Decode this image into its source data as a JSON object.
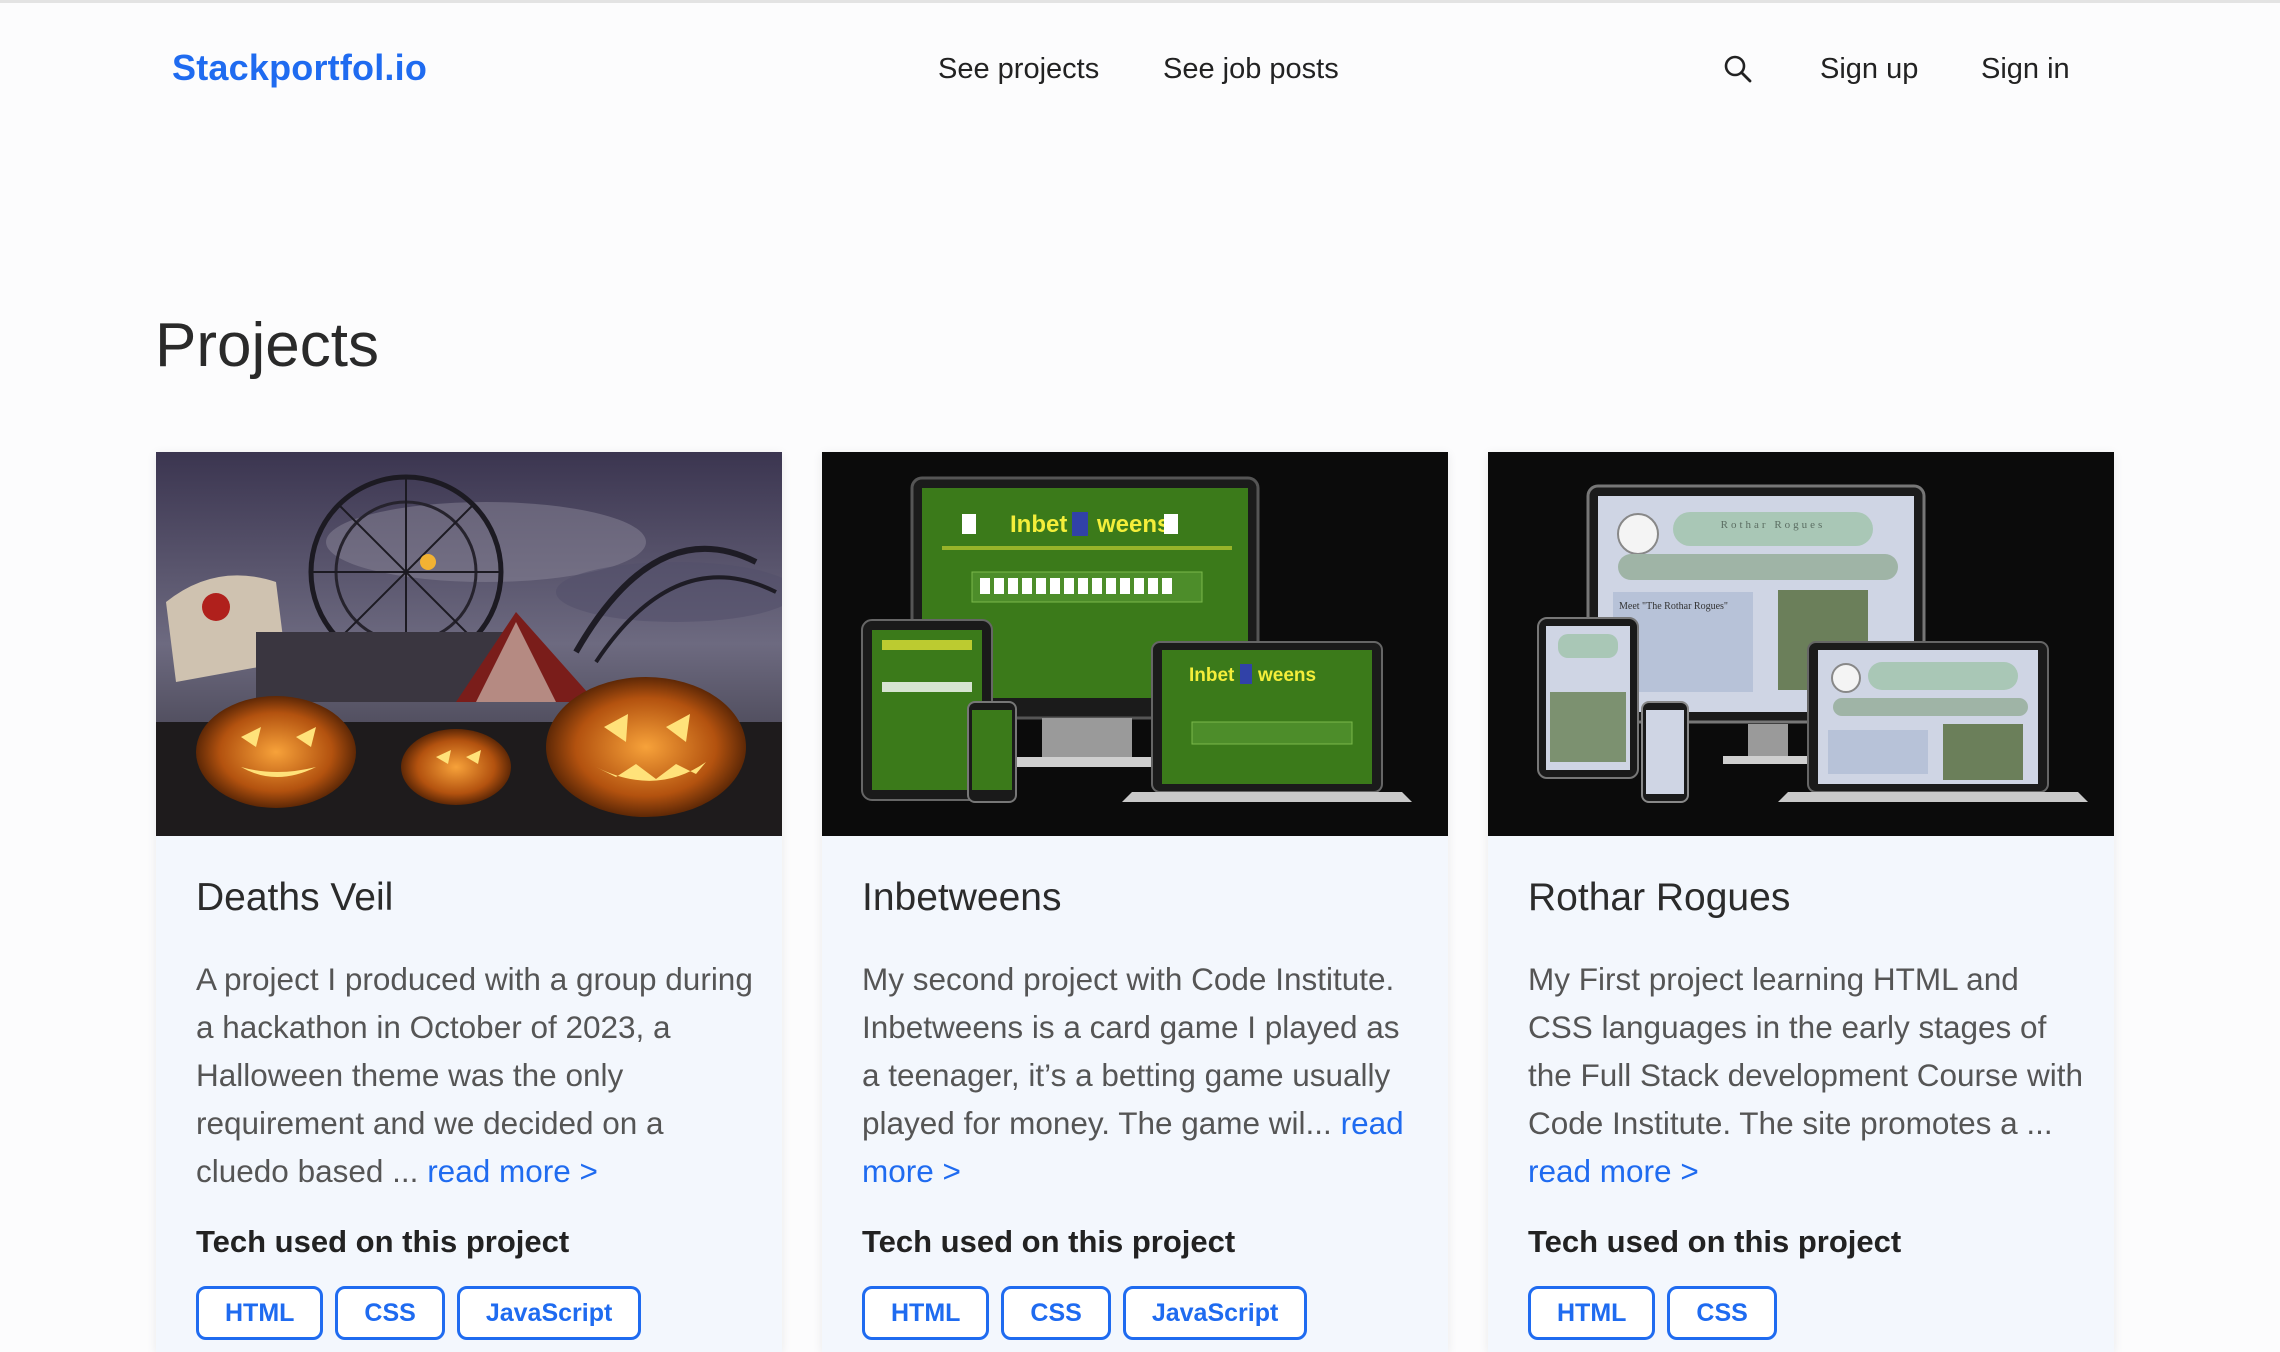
{
  "nav": {
    "brand": "Stackportfol.io",
    "links": [
      "See projects",
      "See job posts"
    ],
    "search_icon": "search-icon",
    "sign_up": "Sign up",
    "sign_in": "Sign in"
  },
  "page_title": "Projects",
  "colors": {
    "accent": "#1f6bf0",
    "card_bg": "#f3f7fd"
  },
  "tech_heading": "Tech used on this project",
  "read_more": "read more >",
  "projects": [
    {
      "title": "Deaths Veil",
      "description": "A project I produced with a group during a hackathon in October of 2023, a Halloween theme was the only requirement and we decided on a cluedo based ...",
      "tech": [
        "HTML",
        "CSS",
        "JavaScript"
      ]
    },
    {
      "title": "Inbetweens",
      "description": "My second project with Code Institute. Inbetweens is a card game I played as a teenager, it’s a betting game usually played for money. The game wil...",
      "tech": [
        "HTML",
        "CSS",
        "JavaScript"
      ],
      "image_text": {
        "left": "Inbet",
        "right": "weens"
      }
    },
    {
      "title": "Rothar Rogues",
      "description": "My First project learning HTML and CSS languages in the early stages of the Full Stack development Course with Code Institute. The site promotes a ...",
      "tech": [
        "HTML",
        "CSS"
      ],
      "image_text": {
        "site_name": "Rothar Rogues",
        "meet": "Meet \"The Rothar Rogues\""
      }
    }
  ]
}
